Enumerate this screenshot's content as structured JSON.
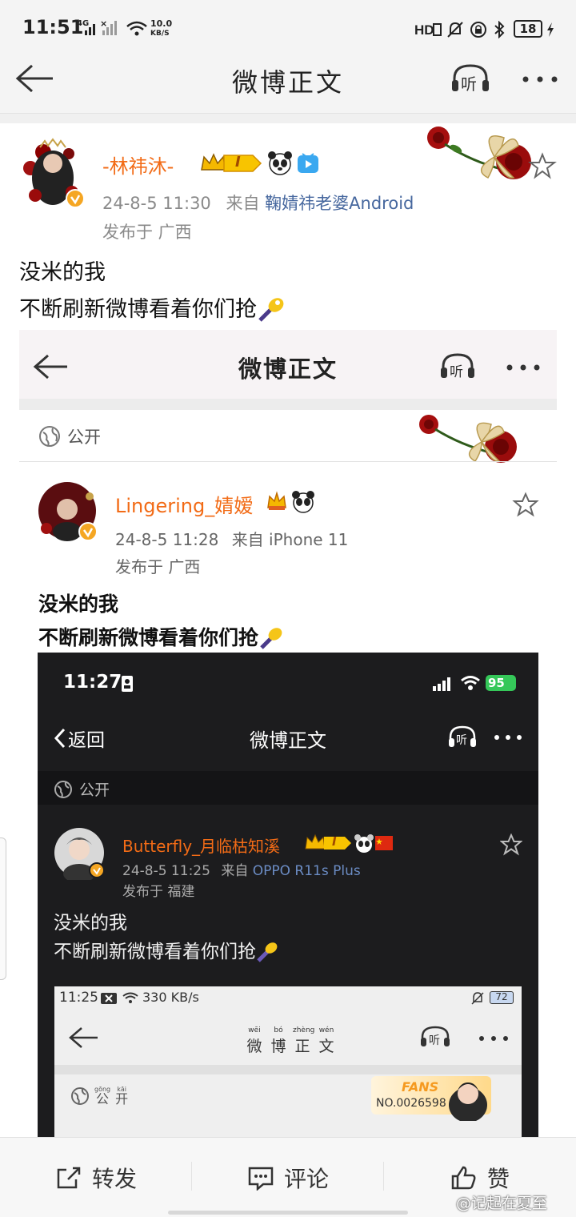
{
  "status_bar": {
    "time": "11:51",
    "network": "4G",
    "speed_value": "10.0",
    "speed_unit": "KB/S",
    "battery": "18"
  },
  "header": {
    "title": "微博正文",
    "listen_label": "听"
  },
  "post": {
    "username": "-林祎沐-",
    "vip_level": "I",
    "timestamp": "24-8-5 11:30",
    "source_prefix": "来自",
    "source_app": "鞠婧祎老婆Android",
    "location": "发布于 广西",
    "text_line1": "没米的我",
    "text_line2": "不断刷新微博看着你们抢"
  },
  "embedded1": {
    "header_title": "微博正文",
    "listen_label": "听",
    "visibility": "公开",
    "username": "Lingering_婧嫒",
    "timestamp": "24-8-5 11:28",
    "source_prefix": "来自",
    "source_app": "iPhone 11",
    "location": "发布于 广西",
    "text_line1": "没米的我",
    "text_line2": "不断刷新微博看着你们抢"
  },
  "embedded2": {
    "time": "11:27",
    "battery": "95",
    "back_label": "返回",
    "header_title": "微博正文",
    "listen_label": "听",
    "visibility": "公开",
    "username": "Butterfly_月临枯知溪",
    "vip_level": "I",
    "timestamp": "24-8-5 11:25",
    "source_prefix": "来自",
    "source_app": "OPPO R11s Plus",
    "location": "发布于 福建",
    "text_line1": "没米的我",
    "text_line2": "不断刷新微博看着你们抢"
  },
  "embedded3": {
    "time": "11:25",
    "speed": "330 KB/s",
    "battery": "72",
    "pinyin": [
      "wēi",
      "bó",
      "zhèng",
      "wén"
    ],
    "title_chars": [
      "微",
      "博",
      "正",
      "文"
    ],
    "listen_label": "听",
    "visibility_pinyin": [
      "gōng",
      "kāi"
    ],
    "visibility": "公开",
    "fans_label": "FANS",
    "fans_number": "NO.0026598"
  },
  "bottom_bar": {
    "repost": "转发",
    "comment": "评论",
    "like": "赞"
  },
  "watermark": "@记起在夏至",
  "colors": {
    "username": "#f26b16",
    "link": "#46679e",
    "meta": "#8a8a8a",
    "vip_gold": "#f5b800",
    "dark_bg": "#1c1c1e"
  }
}
